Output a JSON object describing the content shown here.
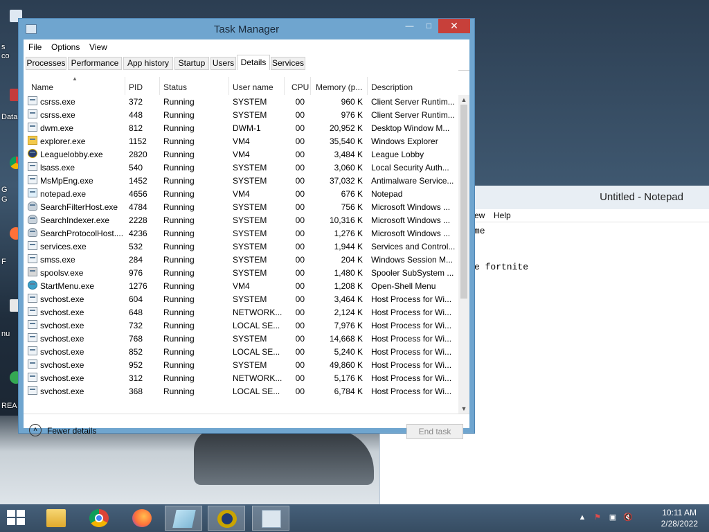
{
  "desktop": {
    "icon_labels": [
      "s",
      "co",
      "Data",
      "G",
      "G",
      "F",
      "nu",
      "REA"
    ]
  },
  "notepad": {
    "title": "Untitled - Notepad",
    "menu": [
      "ew",
      "Help"
    ],
    "lines": [
      "me",
      "",
      "e fortnite"
    ]
  },
  "task_manager": {
    "title": "Task Manager",
    "menu": [
      "File",
      "Options",
      "View"
    ],
    "tabs": [
      "Processes",
      "Performance",
      "App history",
      "Startup",
      "Users",
      "Details",
      "Services"
    ],
    "active_tab": "Details",
    "columns": [
      "Name",
      "PID",
      "Status",
      "User name",
      "CPU",
      "Memory (p...",
      "Description"
    ],
    "rows": [
      {
        "icon": "generic",
        "name": "csrss.exe",
        "pid": "372",
        "status": "Running",
        "user": "SYSTEM",
        "cpu": "00",
        "mem": "960 K",
        "desc": "Client Server Runtim..."
      },
      {
        "icon": "generic",
        "name": "csrss.exe",
        "pid": "448",
        "status": "Running",
        "user": "SYSTEM",
        "cpu": "00",
        "mem": "976 K",
        "desc": "Client Server Runtim..."
      },
      {
        "icon": "generic",
        "name": "dwm.exe",
        "pid": "812",
        "status": "Running",
        "user": "DWM-1",
        "cpu": "00",
        "mem": "20,952 K",
        "desc": "Desktop Window M..."
      },
      {
        "icon": "folder",
        "name": "explorer.exe",
        "pid": "1152",
        "status": "Running",
        "user": "VM4",
        "cpu": "00",
        "mem": "35,540 K",
        "desc": "Windows Explorer"
      },
      {
        "icon": "lol",
        "name": "Leaguelobby.exe",
        "pid": "2820",
        "status": "Running",
        "user": "VM4",
        "cpu": "00",
        "mem": "3,484 K",
        "desc": "League Lobby"
      },
      {
        "icon": "generic",
        "name": "lsass.exe",
        "pid": "540",
        "status": "Running",
        "user": "SYSTEM",
        "cpu": "00",
        "mem": "3,060 K",
        "desc": "Local Security Auth..."
      },
      {
        "icon": "generic",
        "name": "MsMpEng.exe",
        "pid": "1452",
        "status": "Running",
        "user": "SYSTEM",
        "cpu": "00",
        "mem": "37,032 K",
        "desc": "Antimalware Service..."
      },
      {
        "icon": "note",
        "name": "notepad.exe",
        "pid": "4656",
        "status": "Running",
        "user": "VM4",
        "cpu": "00",
        "mem": "676 K",
        "desc": "Notepad"
      },
      {
        "icon": "person",
        "name": "SearchFilterHost.exe",
        "pid": "4784",
        "status": "Running",
        "user": "SYSTEM",
        "cpu": "00",
        "mem": "756 K",
        "desc": "Microsoft Windows ..."
      },
      {
        "icon": "person",
        "name": "SearchIndexer.exe",
        "pid": "2228",
        "status": "Running",
        "user": "SYSTEM",
        "cpu": "00",
        "mem": "10,316 K",
        "desc": "Microsoft Windows ..."
      },
      {
        "icon": "person",
        "name": "SearchProtocolHost....",
        "pid": "4236",
        "status": "Running",
        "user": "SYSTEM",
        "cpu": "00",
        "mem": "1,276 K",
        "desc": "Microsoft Windows ..."
      },
      {
        "icon": "generic",
        "name": "services.exe",
        "pid": "532",
        "status": "Running",
        "user": "SYSTEM",
        "cpu": "00",
        "mem": "1,944 K",
        "desc": "Services and Control..."
      },
      {
        "icon": "generic",
        "name": "smss.exe",
        "pid": "284",
        "status": "Running",
        "user": "SYSTEM",
        "cpu": "00",
        "mem": "204 K",
        "desc": "Windows Session M..."
      },
      {
        "icon": "printer",
        "name": "spoolsv.exe",
        "pid": "976",
        "status": "Running",
        "user": "SYSTEM",
        "cpu": "00",
        "mem": "1,480 K",
        "desc": "Spooler SubSystem ..."
      },
      {
        "icon": "shell",
        "name": "StartMenu.exe",
        "pid": "1276",
        "status": "Running",
        "user": "VM4",
        "cpu": "00",
        "mem": "1,208 K",
        "desc": "Open-Shell Menu"
      },
      {
        "icon": "generic",
        "name": "svchost.exe",
        "pid": "604",
        "status": "Running",
        "user": "SYSTEM",
        "cpu": "00",
        "mem": "3,464 K",
        "desc": "Host Process for Wi..."
      },
      {
        "icon": "generic",
        "name": "svchost.exe",
        "pid": "648",
        "status": "Running",
        "user": "NETWORK...",
        "cpu": "00",
        "mem": "2,124 K",
        "desc": "Host Process for Wi..."
      },
      {
        "icon": "generic",
        "name": "svchost.exe",
        "pid": "732",
        "status": "Running",
        "user": "LOCAL SE...",
        "cpu": "00",
        "mem": "7,976 K",
        "desc": "Host Process for Wi..."
      },
      {
        "icon": "generic",
        "name": "svchost.exe",
        "pid": "768",
        "status": "Running",
        "user": "SYSTEM",
        "cpu": "00",
        "mem": "14,668 K",
        "desc": "Host Process for Wi..."
      },
      {
        "icon": "generic",
        "name": "svchost.exe",
        "pid": "852",
        "status": "Running",
        "user": "LOCAL SE...",
        "cpu": "00",
        "mem": "5,240 K",
        "desc": "Host Process for Wi..."
      },
      {
        "icon": "generic",
        "name": "svchost.exe",
        "pid": "952",
        "status": "Running",
        "user": "SYSTEM",
        "cpu": "00",
        "mem": "49,860 K",
        "desc": "Host Process for Wi..."
      },
      {
        "icon": "generic",
        "name": "svchost.exe",
        "pid": "312",
        "status": "Running",
        "user": "NETWORK...",
        "cpu": "00",
        "mem": "5,176 K",
        "desc": "Host Process for Wi..."
      },
      {
        "icon": "generic",
        "name": "svchost.exe",
        "pid": "368",
        "status": "Running",
        "user": "LOCAL SE...",
        "cpu": "00",
        "mem": "6,784 K",
        "desc": "Host Process for Wi..."
      }
    ],
    "fewer_details_label": "Fewer details",
    "end_task_label": "End task"
  },
  "taskbar": {
    "pinned": [
      "file-explorer-icon",
      "chrome-icon",
      "firefox-icon",
      "notepad-icon",
      "league-of-legends-icon",
      "task-manager-icon"
    ],
    "clock_time": "10:11 AM",
    "clock_date": "2/28/2022"
  }
}
